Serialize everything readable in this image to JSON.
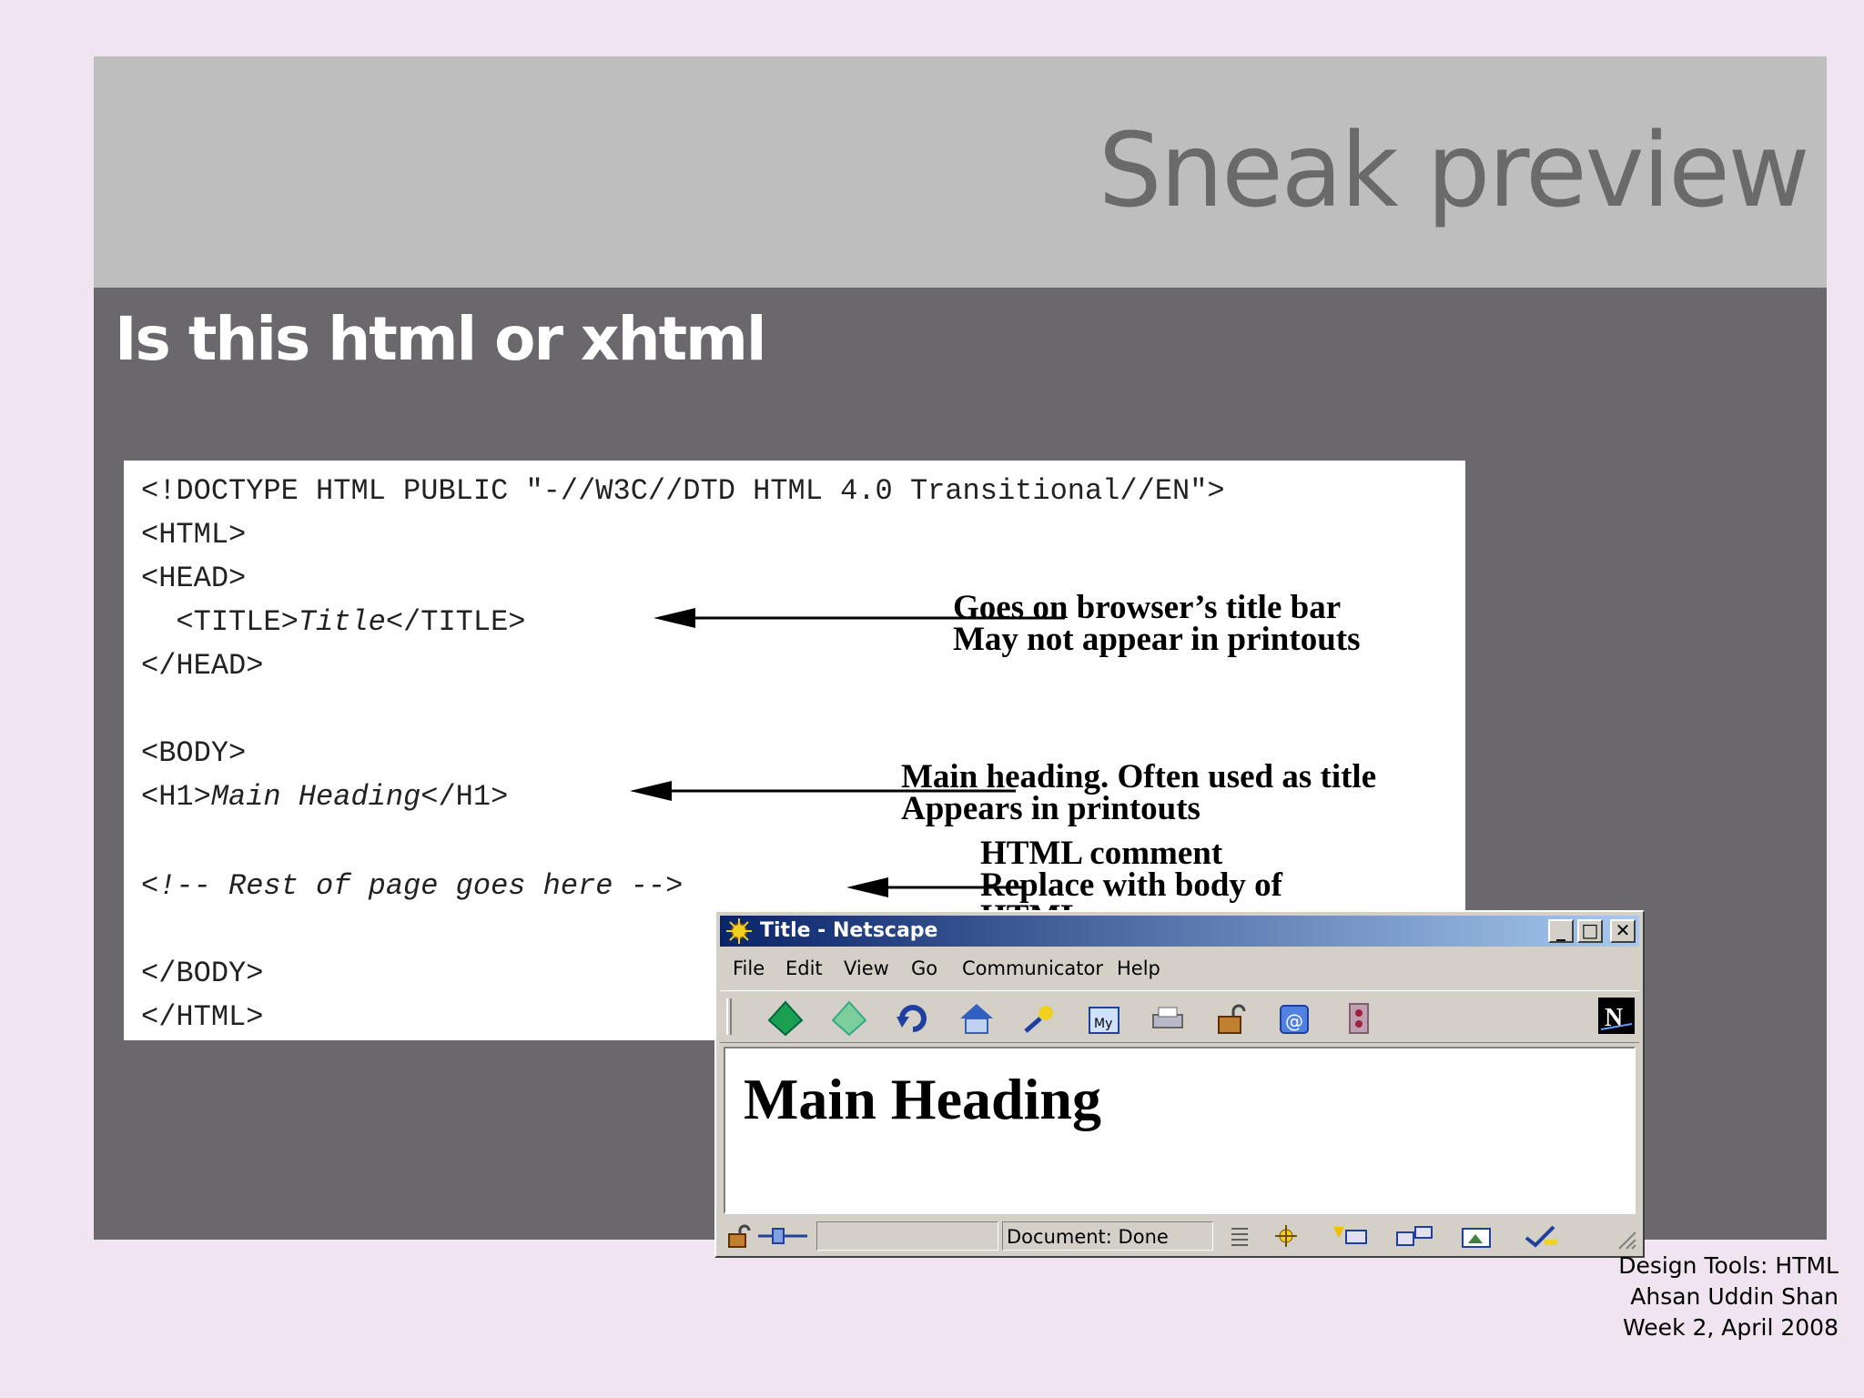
{
  "slide": {
    "title": "Sneak preview",
    "subtitle": "Is this html or xhtml"
  },
  "code": {
    "line1": "<!DOCTYPE HTML PUBLIC \"-//W3C//DTD HTML 4.0 Transitional//EN\">",
    "line2": "<HTML>",
    "line3": "<HEAD>",
    "line4_open": "  <TITLE>",
    "line4_text": "Title",
    "line4_close": "</TITLE>",
    "line5": "</HEAD>",
    "line6": "<BODY>",
    "line7_open": "<H1>",
    "line7_text": "Main Heading",
    "line7_close": "</H1>",
    "line8": "<!-- Rest of page goes here -->",
    "line9": "</BODY>",
    "line10": "</HTML>"
  },
  "annotations": {
    "title_1": "Goes on browser’s title bar",
    "title_2": "May not appear in printouts",
    "h1_1": "Main heading. Often used as title",
    "h1_2": "Appears in printouts",
    "comment_1": "HTML comment",
    "comment_2": "Replace with body of",
    "comment_3": "HTML"
  },
  "browser": {
    "window_title": "Title - Netscape",
    "minimize": "_",
    "maximize": "□",
    "close": "✕",
    "menu": [
      "File",
      "Edit",
      "View",
      "Go",
      "Communicator",
      "Help"
    ],
    "toolbar_icons": [
      "back-icon",
      "forward-icon",
      "reload-icon",
      "home-icon",
      "search-icon",
      "my-netscape-icon",
      "print-icon",
      "security-icon",
      "shop-icon",
      "stop-icon",
      "netscape-logo-icon"
    ],
    "page_heading": "Main Heading",
    "status": "Document: Done",
    "accent": "#0a246a"
  },
  "footer": {
    "line1": "Design Tools: HTML",
    "line2": "Ahsan Uddin Shan",
    "line3": "Week 2, April 2008"
  }
}
